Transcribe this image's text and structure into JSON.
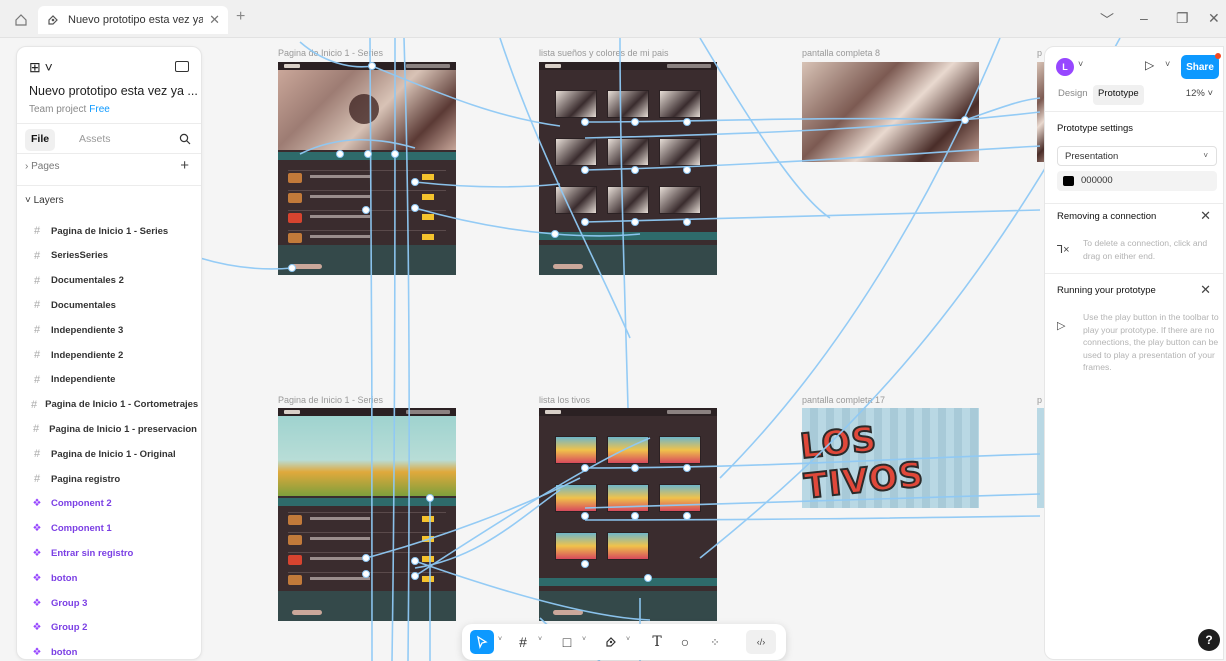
{
  "window": {
    "tab_title": "Nuevo prototipo esta vez ya defi",
    "new_tab": "+",
    "controls": [
      "﹀",
      "–",
      "❐",
      "✕"
    ]
  },
  "canvas": {
    "frames": [
      {
        "label": "Pagina de Inicio 1 - Series"
      },
      {
        "label": "lista sueños y colores de mi pais"
      },
      {
        "label": "pantalla completa 8"
      },
      {
        "label": "p"
      },
      {
        "label": "Pagina de Inicio 1 - Series"
      },
      {
        "label": "lista los tivos"
      },
      {
        "label": "pantalla completa 17"
      },
      {
        "label": "p"
      }
    ],
    "poster_text": "LOS TIVOS"
  },
  "left_panel": {
    "project_title": "Nuevo prototipo esta vez ya ...",
    "team": "Team project",
    "plan": "Free",
    "tabs": {
      "file": "File",
      "assets": "Assets"
    },
    "pages_label": "Pages",
    "layers_label": "Layers",
    "layers": [
      {
        "name": "Pagina de Inicio 1 - Series",
        "type": "frame"
      },
      {
        "name": "SeriesSeries",
        "type": "frame"
      },
      {
        "name": "Documentales 2",
        "type": "frame"
      },
      {
        "name": "Documentales",
        "type": "frame"
      },
      {
        "name": "Independiente 3",
        "type": "frame"
      },
      {
        "name": "Independiente 2",
        "type": "frame"
      },
      {
        "name": "Independiente",
        "type": "frame"
      },
      {
        "name": "Pagina de Inicio 1 - Cortometrajes",
        "type": "frame"
      },
      {
        "name": "Pagina de Inicio 1 - preservacion",
        "type": "frame"
      },
      {
        "name": "Pagina de Inicio 1 - Original",
        "type": "frame"
      },
      {
        "name": "Pagina registro",
        "type": "frame"
      },
      {
        "name": "Component 2",
        "type": "component"
      },
      {
        "name": "Component 1",
        "type": "component"
      },
      {
        "name": "Entrar sin registro",
        "type": "component"
      },
      {
        "name": "boton",
        "type": "component"
      },
      {
        "name": "Group 3",
        "type": "component"
      },
      {
        "name": "Group 2",
        "type": "component"
      },
      {
        "name": "boton",
        "type": "component"
      }
    ]
  },
  "right_panel": {
    "avatar_initial": "L",
    "share_label": "Share",
    "tabs": {
      "design": "Design",
      "prototype": "Prototype"
    },
    "zoom": "12%",
    "prototype_settings": "Prototype settings",
    "device": "Presentation",
    "background_color": "000000",
    "removing_title": "Removing a connection",
    "removing_text": "To delete a connection, click and drag on either end.",
    "running_title": "Running your prototype",
    "running_text": "Use the play button in the toolbar to play your prototype. If there are no connections, the play button can be used to play a presentation of your frames."
  },
  "toolbar": {
    "tools": [
      "move",
      "frame",
      "shape",
      "pen",
      "text",
      "comment",
      "actions"
    ],
    "text_tool_glyph": "T",
    "dev_mode_glyph": "‹/›"
  },
  "help_label": "?",
  "colors": {
    "accent": "#0d99ff",
    "component": "#9747ff",
    "frame_bg": "#3a2c2e",
    "wire": "#8fc9f5"
  }
}
